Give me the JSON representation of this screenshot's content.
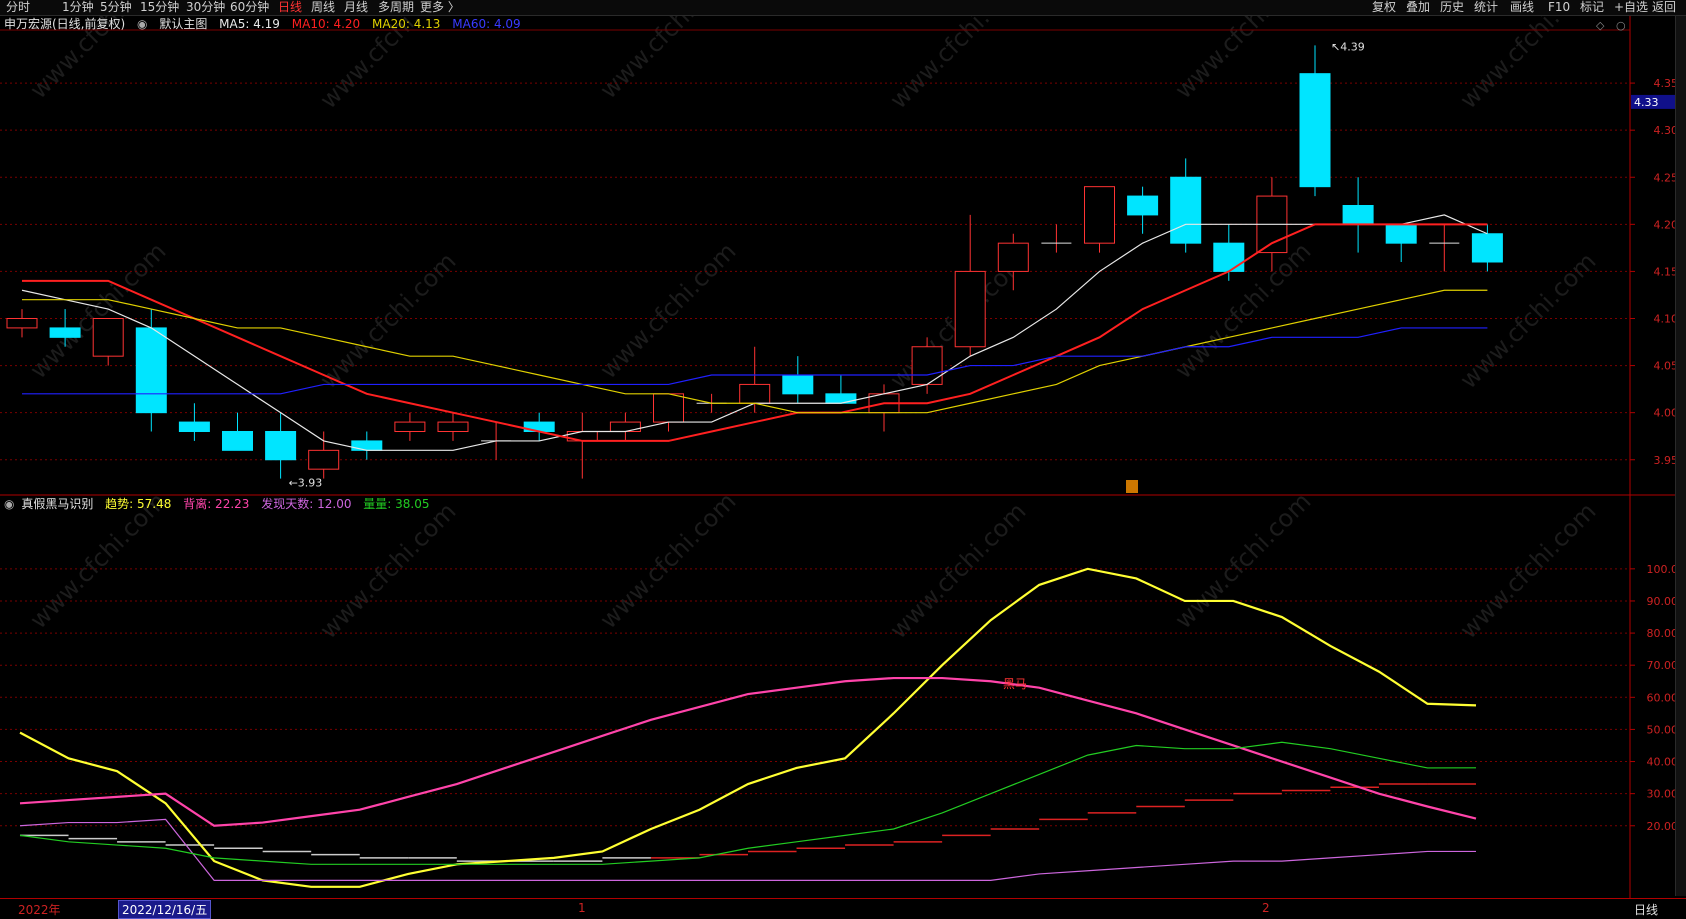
{
  "toolbar": {
    "left_items": [
      "分时",
      "1分钟",
      "5分钟",
      "15分钟",
      "30分钟",
      "60分钟",
      "日线",
      "周线",
      "月线",
      "多周期",
      "更多 〉"
    ],
    "active_item": "日线",
    "right_items": [
      "复权",
      "叠加",
      "历史",
      "统计",
      "画线",
      "F10",
      "标记",
      "+自选",
      "返回"
    ]
  },
  "main_legend": {
    "stock": "申万宏源(日线,前复权)",
    "indicator": "默认主图",
    "ma5": "MA5: 4.19",
    "ma10": "MA10: 4.20",
    "ma20": "MA20: 4.13",
    "ma60": "MA60: 4.09"
  },
  "sub_legend": {
    "indicator": "真假黑马识别",
    "trend": "趋势: 57.48",
    "divergence": "背离: 22.23",
    "days": "发现天数: 12.00",
    "volume": "量量: 38.05"
  },
  "bottom_bar": {
    "year_label": "2022年",
    "cursor_date": "2022/12/16/五",
    "month_1": "1",
    "month_2": "2",
    "period": "日线"
  },
  "price_tag": "4.33",
  "colors": {
    "up": "#ff3333",
    "down": "#00e5ff",
    "ma5": "#e8e8e8",
    "ma10": "#ff2020",
    "ma20": "#e0d000",
    "ma60": "#2020ff",
    "trend": "#ffff33",
    "divergence": "#ff44aa",
    "days": "#cc66dd",
    "volume": "#22cc22",
    "grid": "#7a0000"
  },
  "chart_data": [
    {
      "type": "candlestick",
      "title": "申万宏源(日线,前复权)",
      "y_ticks": [
        "4.35",
        "4.30",
        "4.25",
        "4.20",
        "4.15",
        "4.10",
        "4.05",
        "4.00",
        "3.95"
      ],
      "ylim": [
        3.92,
        4.4
      ],
      "candles": [
        {
          "o": 4.09,
          "h": 4.11,
          "l": 4.08,
          "c": 4.1
        },
        {
          "o": 4.09,
          "h": 4.11,
          "l": 4.07,
          "c": 4.08
        },
        {
          "o": 4.06,
          "h": 4.1,
          "l": 4.05,
          "c": 4.1
        },
        {
          "o": 4.09,
          "h": 4.11,
          "l": 3.98,
          "c": 4.0
        },
        {
          "o": 3.99,
          "h": 4.01,
          "l": 3.97,
          "c": 3.98
        },
        {
          "o": 3.98,
          "h": 4.0,
          "l": 3.96,
          "c": 3.96
        },
        {
          "o": 3.98,
          "h": 4.0,
          "l": 3.93,
          "c": 3.95
        },
        {
          "o": 3.94,
          "h": 3.98,
          "l": 3.93,
          "c": 3.96
        },
        {
          "o": 3.97,
          "h": 3.98,
          "l": 3.95,
          "c": 3.96
        },
        {
          "o": 3.98,
          "h": 4.0,
          "l": 3.97,
          "c": 3.99
        },
        {
          "o": 3.98,
          "h": 4.0,
          "l": 3.97,
          "c": 3.99
        },
        {
          "o": 3.97,
          "h": 3.99,
          "l": 3.95,
          "c": 3.97
        },
        {
          "o": 3.99,
          "h": 4.0,
          "l": 3.97,
          "c": 3.98
        },
        {
          "o": 3.97,
          "h": 4.0,
          "l": 3.93,
          "c": 3.98
        },
        {
          "o": 3.98,
          "h": 4.0,
          "l": 3.97,
          "c": 3.99
        },
        {
          "o": 3.99,
          "h": 4.02,
          "l": 3.98,
          "c": 4.02
        },
        {
          "o": 4.01,
          "h": 4.02,
          "l": 4.0,
          "c": 4.01
        },
        {
          "o": 4.01,
          "h": 4.07,
          "l": 4.0,
          "c": 4.03
        },
        {
          "o": 4.04,
          "h": 4.06,
          "l": 4.01,
          "c": 4.02
        },
        {
          "o": 4.02,
          "h": 4.04,
          "l": 4.01,
          "c": 4.01
        },
        {
          "o": 4.0,
          "h": 4.03,
          "l": 3.98,
          "c": 4.02
        },
        {
          "o": 4.03,
          "h": 4.08,
          "l": 4.02,
          "c": 4.07
        },
        {
          "o": 4.07,
          "h": 4.21,
          "l": 4.06,
          "c": 4.15
        },
        {
          "o": 4.15,
          "h": 4.19,
          "l": 4.13,
          "c": 4.18
        },
        {
          "o": 4.18,
          "h": 4.2,
          "l": 4.17,
          "c": 4.18
        },
        {
          "o": 4.18,
          "h": 4.24,
          "l": 4.17,
          "c": 4.24
        },
        {
          "o": 4.23,
          "h": 4.24,
          "l": 4.19,
          "c": 4.21
        },
        {
          "o": 4.25,
          "h": 4.27,
          "l": 4.17,
          "c": 4.18
        },
        {
          "o": 4.18,
          "h": 4.2,
          "l": 4.14,
          "c": 4.15
        },
        {
          "o": 4.17,
          "h": 4.25,
          "l": 4.15,
          "c": 4.23
        },
        {
          "o": 4.36,
          "h": 4.39,
          "l": 4.23,
          "c": 4.24
        },
        {
          "o": 4.22,
          "h": 4.25,
          "l": 4.17,
          "c": 4.2
        },
        {
          "o": 4.2,
          "h": 4.2,
          "l": 4.16,
          "c": 4.18
        },
        {
          "o": 4.18,
          "h": 4.2,
          "l": 4.15,
          "c": 4.18
        },
        {
          "o": 4.19,
          "h": 4.2,
          "l": 4.15,
          "c": 4.16
        }
      ],
      "series": [
        {
          "name": "MA5",
          "values": [
            4.13,
            4.12,
            4.11,
            4.09,
            4.06,
            4.03,
            4.0,
            3.97,
            3.96,
            3.96,
            3.96,
            3.97,
            3.97,
            3.98,
            3.98,
            3.99,
            3.99,
            4.01,
            4.01,
            4.01,
            4.02,
            4.03,
            4.06,
            4.08,
            4.11,
            4.15,
            4.18,
            4.2,
            4.2,
            4.2,
            4.2,
            4.2,
            4.2,
            4.21,
            4.19
          ]
        },
        {
          "name": "MA10",
          "values": [
            4.14,
            4.14,
            4.14,
            4.12,
            4.1,
            4.08,
            4.06,
            4.04,
            4.02,
            4.01,
            4.0,
            3.99,
            3.98,
            3.97,
            3.97,
            3.97,
            3.98,
            3.99,
            4.0,
            4.0,
            4.01,
            4.01,
            4.02,
            4.04,
            4.06,
            4.08,
            4.11,
            4.13,
            4.15,
            4.18,
            4.2,
            4.2,
            4.2,
            4.2,
            4.2
          ]
        },
        {
          "name": "MA20",
          "values": [
            4.12,
            4.12,
            4.12,
            4.11,
            4.1,
            4.09,
            4.09,
            4.08,
            4.07,
            4.06,
            4.06,
            4.05,
            4.04,
            4.03,
            4.02,
            4.02,
            4.01,
            4.01,
            4.0,
            4.0,
            4.0,
            4.0,
            4.01,
            4.02,
            4.03,
            4.05,
            4.06,
            4.07,
            4.08,
            4.09,
            4.1,
            4.11,
            4.12,
            4.13,
            4.13
          ]
        },
        {
          "name": "MA60",
          "values": [
            4.02,
            4.02,
            4.02,
            4.02,
            4.02,
            4.02,
            4.02,
            4.03,
            4.03,
            4.03,
            4.03,
            4.03,
            4.03,
            4.03,
            4.03,
            4.03,
            4.04,
            4.04,
            4.04,
            4.04,
            4.04,
            4.04,
            4.05,
            4.05,
            4.06,
            4.06,
            4.06,
            4.07,
            4.07,
            4.08,
            4.08,
            4.08,
            4.09,
            4.09,
            4.09
          ]
        }
      ],
      "annotations": [
        {
          "label": "4.39"
        },
        {
          "label": "3.93"
        }
      ]
    },
    {
      "type": "line",
      "title": "真假黑马识别",
      "y_ticks": [
        "100.0",
        "90.00",
        "80.00",
        "70.00",
        "60.00",
        "50.00",
        "40.00",
        "30.00",
        "20.00"
      ],
      "ylim": [
        0,
        104
      ],
      "annotation": "黑马",
      "series": [
        {
          "name": "趋势",
          "values": [
            49,
            41,
            37,
            27,
            9,
            3,
            1,
            1,
            5,
            8,
            9,
            10,
            12,
            19,
            25,
            33,
            38,
            41,
            55,
            70,
            84,
            95,
            100,
            97,
            90,
            90,
            85,
            76,
            68,
            58,
            57.48
          ]
        },
        {
          "name": "背离",
          "values": [
            27,
            28,
            29,
            30,
            20,
            21,
            23,
            25,
            29,
            33,
            38,
            43,
            48,
            53,
            57,
            61,
            63,
            65,
            66,
            66,
            65,
            63,
            59,
            55,
            50,
            45,
            40,
            35,
            30,
            26,
            22.23
          ]
        },
        {
          "name": "发现天数",
          "values": [
            20,
            21,
            21,
            22,
            3,
            3,
            3,
            3,
            3,
            3,
            3,
            3,
            3,
            3,
            3,
            3,
            3,
            3,
            3,
            3,
            3,
            5,
            6,
            7,
            8,
            9,
            9,
            10,
            11,
            12,
            12.0
          ]
        },
        {
          "name": "量量",
          "values": [
            17,
            15,
            14,
            13,
            10,
            9,
            8,
            8,
            8,
            8,
            8,
            8,
            8,
            9,
            10,
            13,
            15,
            17,
            19,
            24,
            30,
            36,
            42,
            45,
            44,
            44,
            46,
            44,
            41,
            38,
            38.05
          ]
        }
      ]
    }
  ]
}
